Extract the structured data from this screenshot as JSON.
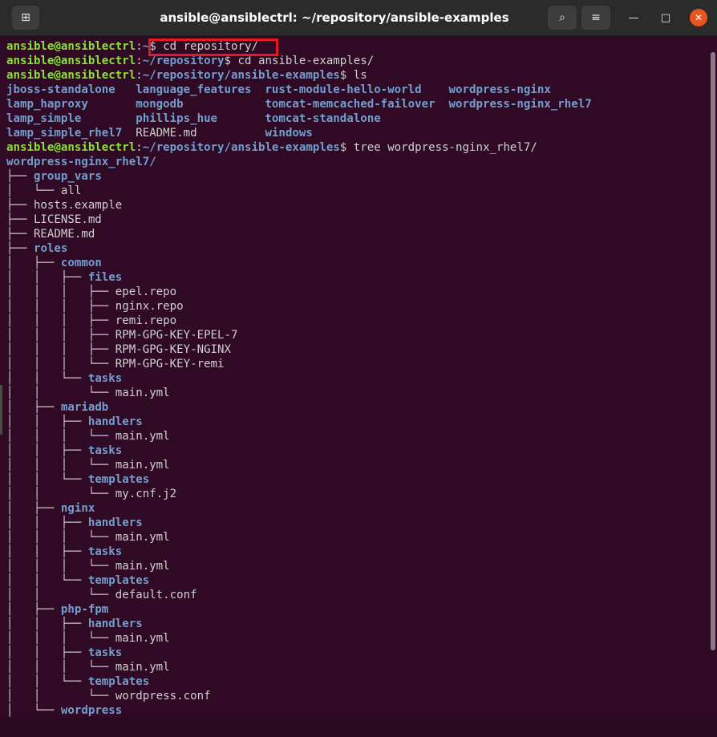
{
  "window": {
    "title": "ansible@ansiblectrl: ~/repository/ansible-examples",
    "new_tab_icon": "⊞",
    "search_icon": "⌕",
    "menu_icon": "≡",
    "minimize_icon": "—",
    "maximize_icon": "□",
    "close_icon": "✕",
    "accent_close": "#e95420"
  },
  "colors": {
    "background": "#300a24",
    "user_host": "#8ae234",
    "path": "#729fcf",
    "text": "#d0d0d0",
    "highlight_box": "#e01b24"
  },
  "terminal": {
    "lines": [
      {
        "segments": [
          {
            "cls": "u",
            "text": "ansible@ansiblectrl"
          },
          {
            "cls": "n",
            "text": ":"
          },
          {
            "cls": "p",
            "text": "~"
          },
          {
            "cls": "n",
            "text": "$ cd repository/"
          }
        ]
      },
      {
        "segments": [
          {
            "cls": "u",
            "text": "ansible@ansiblectrl"
          },
          {
            "cls": "n",
            "text": ":"
          },
          {
            "cls": "p",
            "text": "~/repository"
          },
          {
            "cls": "n",
            "text": "$ cd ansible-examples/"
          }
        ]
      },
      {
        "segments": [
          {
            "cls": "u",
            "text": "ansible@ansiblectrl"
          },
          {
            "cls": "n",
            "text": ":"
          },
          {
            "cls": "p",
            "text": "~/repository/ansible-examples"
          },
          {
            "cls": "n",
            "text": "$ ls"
          }
        ]
      },
      {
        "segments": [
          {
            "cls": "d",
            "text": "jboss-standalone   language_features  rust-module-hello-world    wordpress-nginx"
          }
        ]
      },
      {
        "segments": [
          {
            "cls": "d",
            "text": "lamp_haproxy       mongodb            tomcat-memcached-failover  wordpress-nginx_rhel7"
          }
        ]
      },
      {
        "segments": [
          {
            "cls": "d",
            "text": "lamp_simple        phillips_hue       tomcat-standalone"
          }
        ]
      },
      {
        "segments": [
          {
            "cls": "d",
            "text": "lamp_simple_rhel7  "
          },
          {
            "cls": "n",
            "text": "README.md          "
          },
          {
            "cls": "d",
            "text": "windows"
          }
        ]
      },
      {
        "segments": [
          {
            "cls": "u",
            "text": "ansible@ansiblectrl"
          },
          {
            "cls": "n",
            "text": ":"
          },
          {
            "cls": "p",
            "text": "~/repository/ansible-examples"
          },
          {
            "cls": "n",
            "text": "$ tree wordpress-nginx_rhel7/"
          }
        ]
      },
      {
        "segments": [
          {
            "cls": "d",
            "text": "wordpress-nginx_rhel7/"
          }
        ]
      },
      {
        "segments": [
          {
            "cls": "t",
            "text": "├── "
          },
          {
            "cls": "d",
            "text": "group_vars"
          }
        ]
      },
      {
        "segments": [
          {
            "cls": "t",
            "text": "│   └── all"
          }
        ]
      },
      {
        "segments": [
          {
            "cls": "t",
            "text": "├── hosts.example"
          }
        ]
      },
      {
        "segments": [
          {
            "cls": "t",
            "text": "├── LICENSE.md"
          }
        ]
      },
      {
        "segments": [
          {
            "cls": "t",
            "text": "├── README.md"
          }
        ]
      },
      {
        "segments": [
          {
            "cls": "t",
            "text": "├── "
          },
          {
            "cls": "d",
            "text": "roles"
          }
        ]
      },
      {
        "segments": [
          {
            "cls": "t",
            "text": "│   ├── "
          },
          {
            "cls": "d",
            "text": "common"
          }
        ]
      },
      {
        "segments": [
          {
            "cls": "t",
            "text": "│   │   ├── "
          },
          {
            "cls": "d",
            "text": "files"
          }
        ]
      },
      {
        "segments": [
          {
            "cls": "t",
            "text": "│   │   │   ├── epel.repo"
          }
        ]
      },
      {
        "segments": [
          {
            "cls": "t",
            "text": "│   │   │   ├── nginx.repo"
          }
        ]
      },
      {
        "segments": [
          {
            "cls": "t",
            "text": "│   │   │   ├── remi.repo"
          }
        ]
      },
      {
        "segments": [
          {
            "cls": "t",
            "text": "│   │   │   ├── RPM-GPG-KEY-EPEL-7"
          }
        ]
      },
      {
        "segments": [
          {
            "cls": "t",
            "text": "│   │   │   ├── RPM-GPG-KEY-NGINX"
          }
        ]
      },
      {
        "segments": [
          {
            "cls": "t",
            "text": "│   │   │   └── RPM-GPG-KEY-remi"
          }
        ]
      },
      {
        "segments": [
          {
            "cls": "t",
            "text": "│   │   └── "
          },
          {
            "cls": "d",
            "text": "tasks"
          }
        ]
      },
      {
        "segments": [
          {
            "cls": "t",
            "text": "│   │       └── main.yml"
          }
        ]
      },
      {
        "segments": [
          {
            "cls": "t",
            "text": "│   ├── "
          },
          {
            "cls": "d",
            "text": "mariadb"
          }
        ]
      },
      {
        "segments": [
          {
            "cls": "t",
            "text": "│   │   ├── "
          },
          {
            "cls": "d",
            "text": "handlers"
          }
        ]
      },
      {
        "segments": [
          {
            "cls": "t",
            "text": "│   │   │   └── main.yml"
          }
        ]
      },
      {
        "segments": [
          {
            "cls": "t",
            "text": "│   │   ├── "
          },
          {
            "cls": "d",
            "text": "tasks"
          }
        ]
      },
      {
        "segments": [
          {
            "cls": "t",
            "text": "│   │   │   └── main.yml"
          }
        ]
      },
      {
        "segments": [
          {
            "cls": "t",
            "text": "│   │   └── "
          },
          {
            "cls": "d",
            "text": "templates"
          }
        ]
      },
      {
        "segments": [
          {
            "cls": "t",
            "text": "│   │       └── my.cnf.j2"
          }
        ]
      },
      {
        "segments": [
          {
            "cls": "t",
            "text": "│   ├── "
          },
          {
            "cls": "d",
            "text": "nginx"
          }
        ]
      },
      {
        "segments": [
          {
            "cls": "t",
            "text": "│   │   ├── "
          },
          {
            "cls": "d",
            "text": "handlers"
          }
        ]
      },
      {
        "segments": [
          {
            "cls": "t",
            "text": "│   │   │   └── main.yml"
          }
        ]
      },
      {
        "segments": [
          {
            "cls": "t",
            "text": "│   │   ├── "
          },
          {
            "cls": "d",
            "text": "tasks"
          }
        ]
      },
      {
        "segments": [
          {
            "cls": "t",
            "text": "│   │   │   └── main.yml"
          }
        ]
      },
      {
        "segments": [
          {
            "cls": "t",
            "text": "│   │   └── "
          },
          {
            "cls": "d",
            "text": "templates"
          }
        ]
      },
      {
        "segments": [
          {
            "cls": "t",
            "text": "│   │       └── default.conf"
          }
        ]
      },
      {
        "segments": [
          {
            "cls": "t",
            "text": "│   ├── "
          },
          {
            "cls": "d",
            "text": "php-fpm"
          }
        ]
      },
      {
        "segments": [
          {
            "cls": "t",
            "text": "│   │   ├── "
          },
          {
            "cls": "d",
            "text": "handlers"
          }
        ]
      },
      {
        "segments": [
          {
            "cls": "t",
            "text": "│   │   │   └── main.yml"
          }
        ]
      },
      {
        "segments": [
          {
            "cls": "t",
            "text": "│   │   ├── "
          },
          {
            "cls": "d",
            "text": "tasks"
          }
        ]
      },
      {
        "segments": [
          {
            "cls": "t",
            "text": "│   │   │   └── main.yml"
          }
        ]
      },
      {
        "segments": [
          {
            "cls": "t",
            "text": "│   │   └── "
          },
          {
            "cls": "d",
            "text": "templates"
          }
        ]
      },
      {
        "segments": [
          {
            "cls": "t",
            "text": "│   │       └── wordpress.conf"
          }
        ]
      },
      {
        "segments": [
          {
            "cls": "t",
            "text": "│   └── "
          },
          {
            "cls": "d",
            "text": "wordpress"
          }
        ]
      }
    ]
  }
}
